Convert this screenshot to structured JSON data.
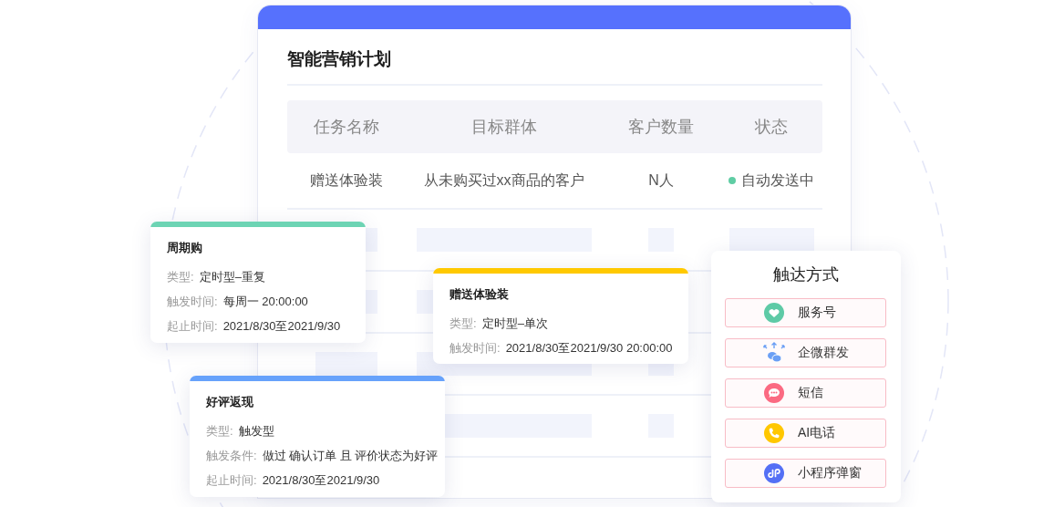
{
  "plan": {
    "title": "智能营销计划",
    "columns": [
      "任务名称",
      "目标群体",
      "客户数量",
      "状态"
    ],
    "rows": [
      {
        "cells": [
          "赠送体验装",
          "从未购买过xx商品的客户",
          "N人"
        ],
        "status": "自动发送中",
        "color": "#5fcda4"
      }
    ]
  },
  "cards": [
    {
      "title": "周期购",
      "color": "#6dd4b4",
      "fields": [
        {
          "label": "类型:",
          "value": "定时型–重复"
        },
        {
          "label": "触发时间:",
          "value": "每周一 20:00:00"
        },
        {
          "label": "起止时间:",
          "value": "2021/8/30至2021/9/30"
        }
      ]
    },
    {
      "title": "赠送体验装",
      "color": "#ffc900",
      "fields": [
        {
          "label": "类型:",
          "value": "定时型–单次"
        },
        {
          "label": "触发时间:",
          "value": "2021/8/30至2021/9/30 20:00:00"
        }
      ]
    },
    {
      "title": "好评返现",
      "color": "#67a2fb",
      "fields": [
        {
          "label": "类型:",
          "value": "触发型"
        },
        {
          "label": "触发条件:",
          "value": "做过 确认订单 且 评价状态为好评"
        },
        {
          "label": "起止时间:",
          "value": "2021/8/30至2021/9/30"
        }
      ]
    }
  ],
  "channels": {
    "title": "触达方式",
    "items": [
      {
        "label": "服务号",
        "kind": "heart",
        "color": "#5ecaa6"
      },
      {
        "label": "企微群发",
        "kind": "wecom",
        "color": "#6b9ff5"
      },
      {
        "label": "短信",
        "kind": "message",
        "color": "#fb6a82"
      },
      {
        "label": "AI电话",
        "kind": "phone",
        "color": "#ffc700"
      },
      {
        "label": "小程序弹窗",
        "kind": "link",
        "color": "#5470f5"
      }
    ]
  }
}
